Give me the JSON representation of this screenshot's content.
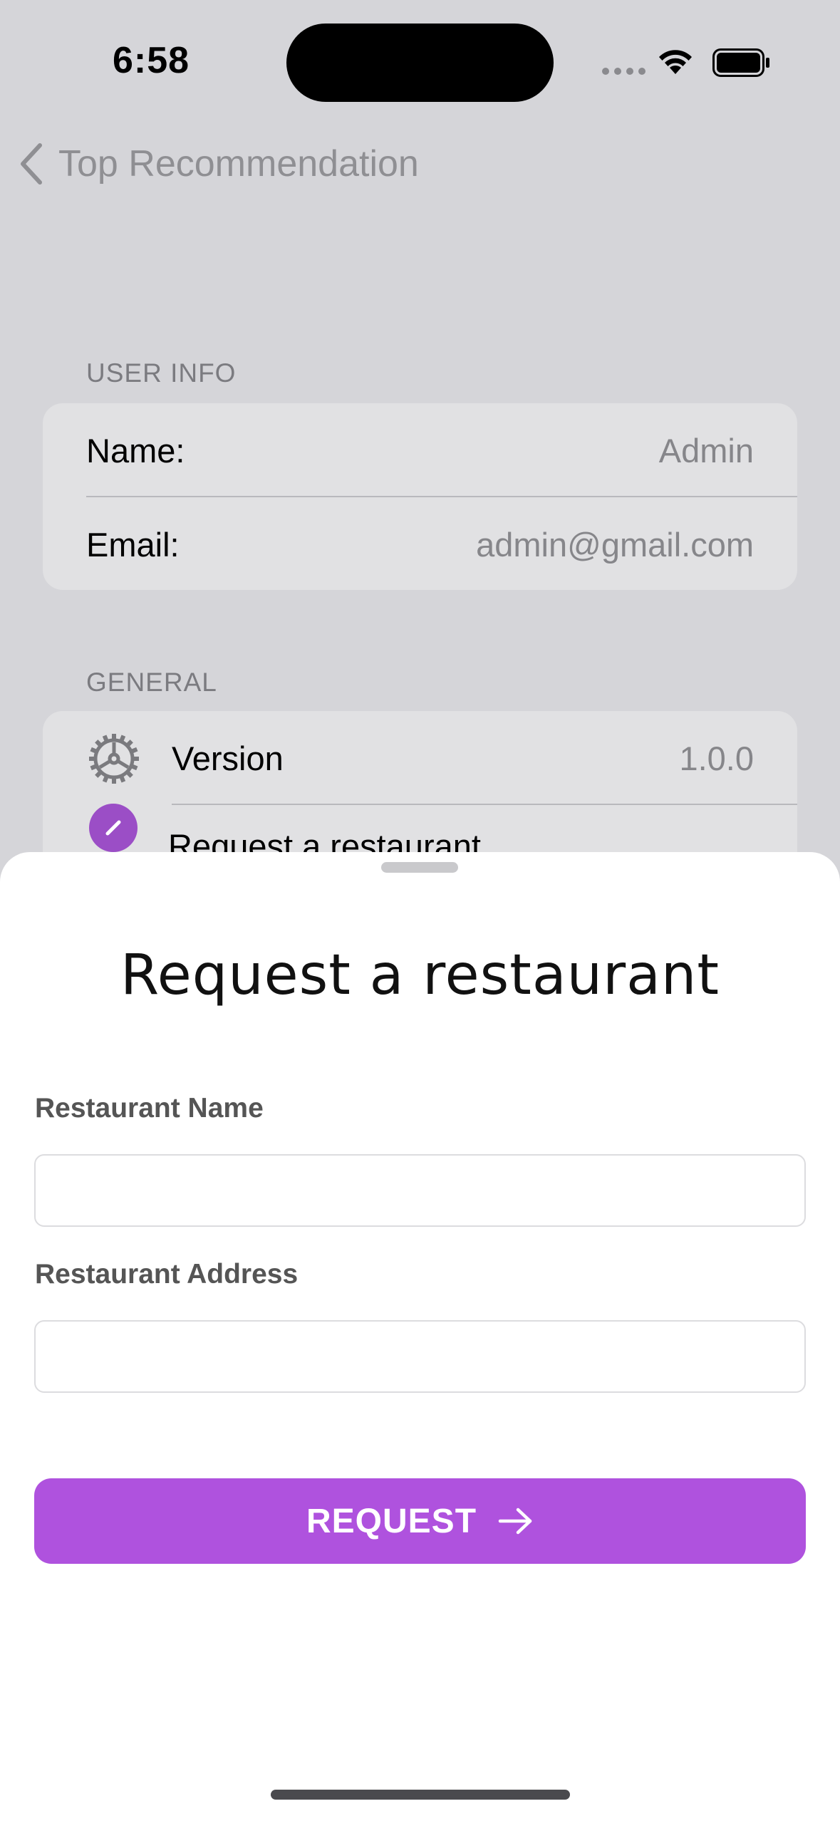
{
  "status_bar": {
    "time": "6:58"
  },
  "nav": {
    "back_label": "Top Recommendation"
  },
  "user_info": {
    "header": "USER INFO",
    "rows": [
      {
        "label": "Name:",
        "value": "Admin"
      },
      {
        "label": "Email:",
        "value": "admin@gmail.com"
      }
    ]
  },
  "general": {
    "header": "GENERAL",
    "rows": [
      {
        "label": "Version",
        "value": "1.0.0",
        "icon": "gear-icon"
      },
      {
        "label": "Request a restaurant",
        "icon": "pencil-icon"
      }
    ]
  },
  "sheet": {
    "title": "Request a restaurant",
    "fields": [
      {
        "label": "Restaurant Name",
        "value": "",
        "placeholder": ""
      },
      {
        "label": "Restaurant Address",
        "value": "",
        "placeholder": ""
      }
    ],
    "button_label": "REQUEST",
    "button_icon": "arrow-right-icon"
  },
  "colors": {
    "accent": "#af52de",
    "backdrop": "#d5d5d9",
    "card": "#e1e1e3"
  }
}
